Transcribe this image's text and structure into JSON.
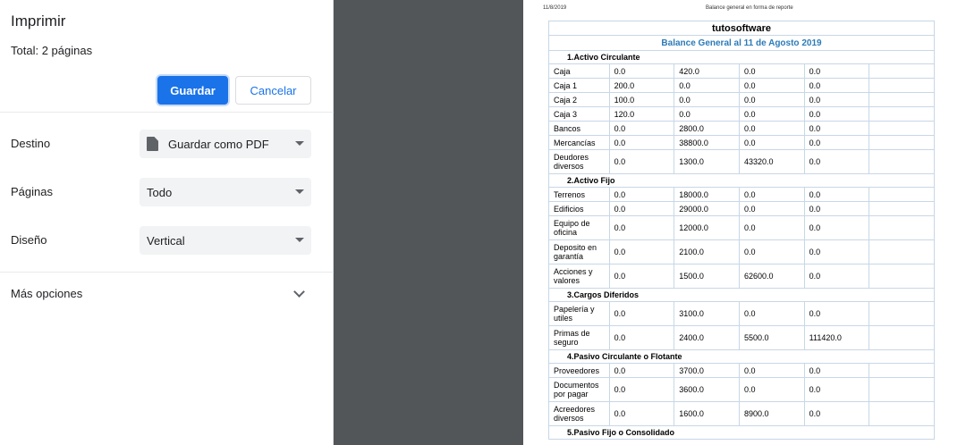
{
  "dialog": {
    "title": "Imprimir",
    "total_prefix": "Total: ",
    "total_value": "2 páginas",
    "save_label": "Guardar",
    "cancel_label": "Cancelar",
    "destination": {
      "label": "Destino",
      "value": "Guardar como PDF",
      "icon": "document-icon"
    },
    "pages": {
      "label": "Páginas",
      "value": "Todo"
    },
    "layout": {
      "label": "Diseño",
      "value": "Vertical"
    },
    "more_options": "Más opciones"
  },
  "preview": {
    "header_date": "11/8/2019",
    "header_title": "Balance general en forma de reporte",
    "company": "tutosoftware",
    "subtitle": "Balance General al 11 de Agosto 2019",
    "sections": [
      {
        "title": "1.Activo Circulante",
        "rows": [
          [
            "Caja",
            "0.0",
            "420.0",
            "0.0",
            "0.0"
          ],
          [
            "Caja 1",
            "200.0",
            "0.0",
            "0.0",
            "0.0"
          ],
          [
            "Caja 2",
            "100.0",
            "0.0",
            "0.0",
            "0.0"
          ],
          [
            "Caja 3",
            "120.0",
            "0.0",
            "0.0",
            "0.0"
          ],
          [
            "Bancos",
            "0.0",
            "2800.0",
            "0.0",
            "0.0"
          ],
          [
            "Mercancías",
            "0.0",
            "38800.0",
            "0.0",
            "0.0"
          ],
          [
            "Deudores diversos",
            "0.0",
            "1300.0",
            "43320.0",
            "0.0"
          ]
        ]
      },
      {
        "title": "2.Activo Fijo",
        "rows": [
          [
            "Terrenos",
            "0.0",
            "18000.0",
            "0.0",
            "0.0"
          ],
          [
            "Edificios",
            "0.0",
            "29000.0",
            "0.0",
            "0.0"
          ],
          [
            "Equipo de oficina",
            "0.0",
            "12000.0",
            "0.0",
            "0.0"
          ],
          [
            "Deposito en garantía",
            "0.0",
            "2100.0",
            "0.0",
            "0.0"
          ],
          [
            "Acciones y valores",
            "0.0",
            "1500.0",
            "62600.0",
            "0.0"
          ]
        ]
      },
      {
        "title": "3.Cargos Diferidos",
        "rows": [
          [
            "Papelería y utiles",
            "0.0",
            "3100.0",
            "0.0",
            "0.0"
          ],
          [
            "Primas de seguro",
            "0.0",
            "2400.0",
            "5500.0",
            "111420.0"
          ]
        ]
      },
      {
        "title": "4.Pasivo Circulante o Flotante",
        "rows": [
          [
            "Proveedores",
            "0.0",
            "3700.0",
            "0.0",
            "0.0"
          ],
          [
            "Documentos por pagar",
            "0.0",
            "3600.0",
            "0.0",
            "0.0"
          ],
          [
            "Acreedores diversos",
            "0.0",
            "1600.0",
            "8900.0",
            "0.0"
          ]
        ]
      },
      {
        "title": "5.Pasivo Fijo o Consolidado",
        "rows": []
      }
    ]
  }
}
